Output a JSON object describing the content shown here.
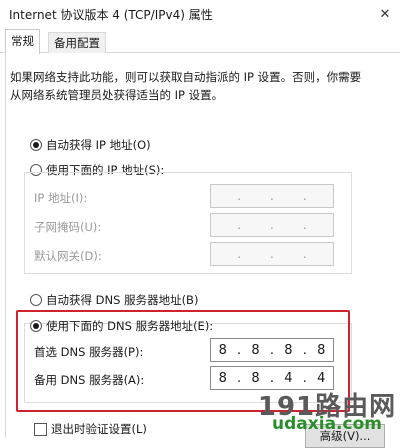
{
  "window": {
    "title": "Internet 协议版本 4 (TCP/IPv4) 属性",
    "close_glyph": "✕"
  },
  "tabs": [
    {
      "label": "常规",
      "active": true
    },
    {
      "label": "备用配置",
      "active": false
    }
  ],
  "description": "如果网络支持此功能，则可以获取自动指派的 IP 设置。否则，你需要从网络系统管理员处获得适当的 IP 设置。",
  "ip_section": {
    "auto_label": "自动获得 IP 地址(O)",
    "manual_label": "使用下面的 IP 地址(S):",
    "selected": "auto",
    "fields": [
      {
        "label": "IP 地址(I):",
        "octets": [
          "",
          "",
          "",
          ""
        ]
      },
      {
        "label": "子网掩码(U):",
        "octets": [
          "",
          "",
          "",
          ""
        ]
      },
      {
        "label": "默认网关(D):",
        "octets": [
          "",
          "",
          "",
          ""
        ]
      }
    ]
  },
  "dns_section": {
    "auto_label": "自动获得 DNS 服务器地址(B)",
    "manual_label": "使用下面的 DNS 服务器地址(E):",
    "selected": "manual",
    "preferred": {
      "label": "首选 DNS 服务器(P):",
      "octets": [
        "8",
        "8",
        "8",
        "8"
      ]
    },
    "alternate": {
      "label": "备用 DNS 服务器(A):",
      "octets": [
        "8",
        "8",
        "4",
        "4"
      ]
    }
  },
  "validate_on_exit": {
    "label": "退出时验证设置(L)",
    "checked": false
  },
  "advanced_button": "高级(V)...",
  "watermark": {
    "line1": "191路由网",
    "line2": "udaxia.com"
  },
  "colors": {
    "highlight_border": "#d0222d",
    "watermark_green": "#2a8f2a"
  }
}
